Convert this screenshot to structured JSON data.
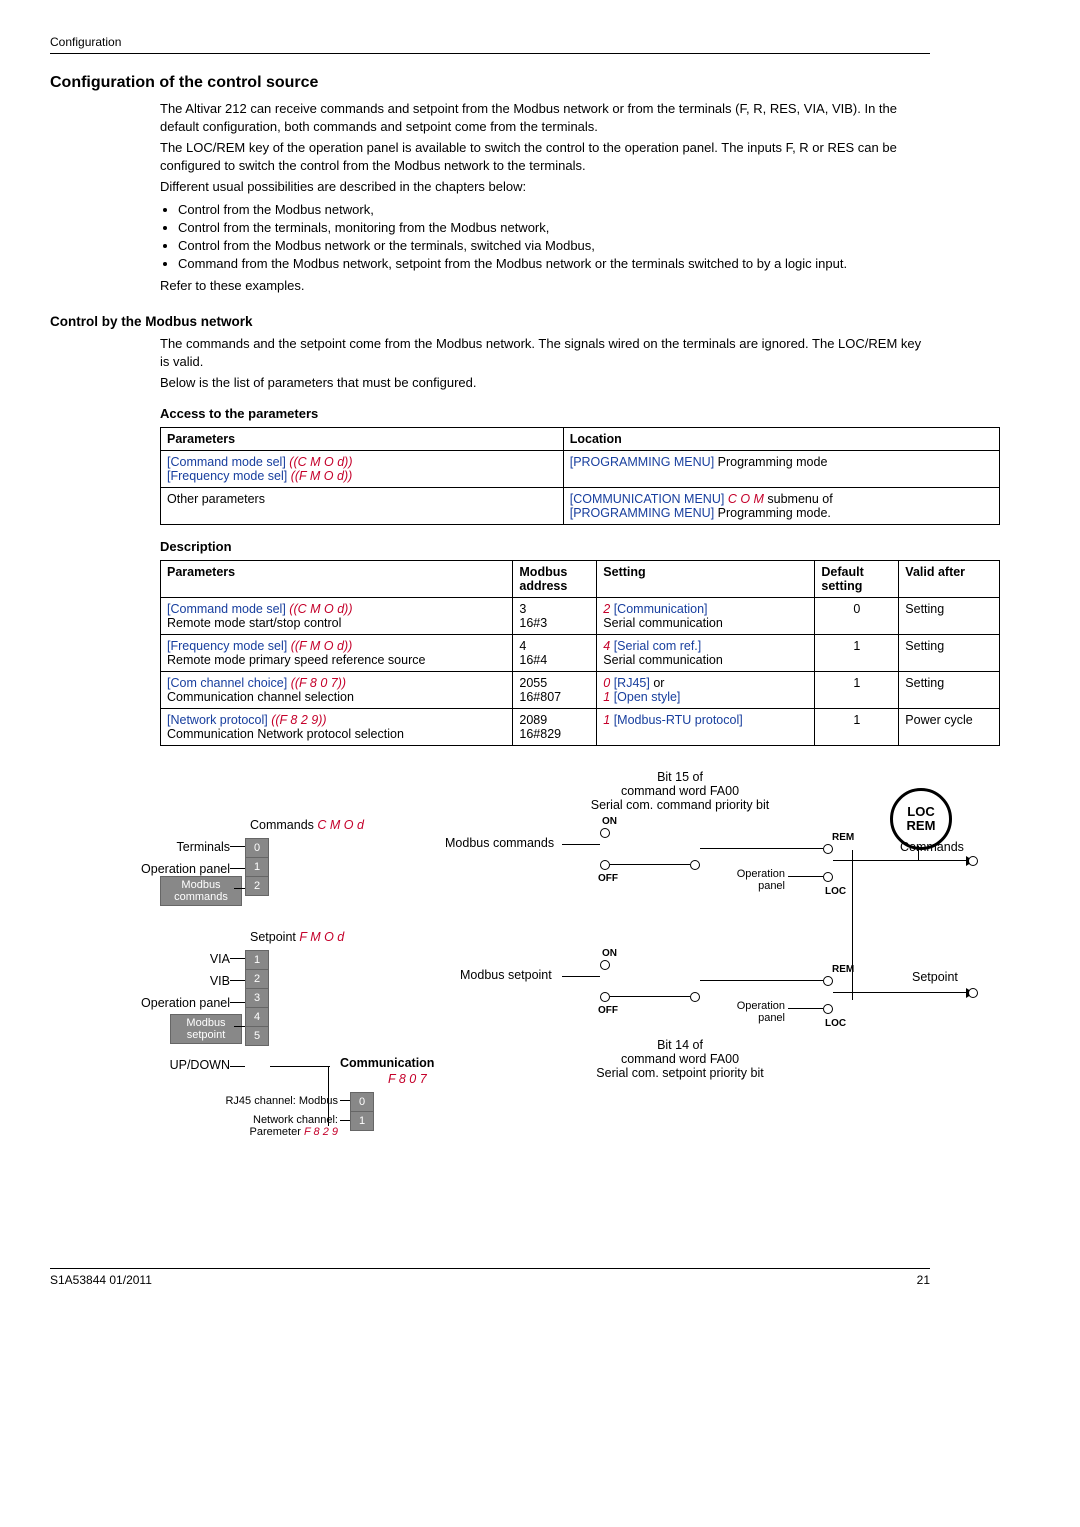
{
  "header": {
    "section": "Configuration"
  },
  "title": "Configuration of the control source",
  "intro": {
    "p1": "The Altivar 212 can receive commands and setpoint from the Modbus network or from the terminals (F, R, RES, VIA, VIB). In the default configuration, both commands and setpoint come from the terminals.",
    "p2": "The LOC/REM key of the operation panel is available to switch the control to the operation panel. The inputs F, R or RES can be configured to switch the control from the Modbus network to the terminals.",
    "p3": "Different usual possibilities are described in the chapters below:",
    "b1": "Control from the Modbus network,",
    "b2": "Control from the terminals, monitoring from the Modbus network,",
    "b3": "Control from the Modbus network or the terminals, switched via Modbus,",
    "b4": "Command from the Modbus network, setpoint from the Modbus network or the terminals switched to by a logic input.",
    "p4": "Refer to these examples."
  },
  "sec1": {
    "h": "Control by the Modbus network",
    "p1": "The commands and the setpoint come from the Modbus network. The signals wired on the terminals are ignored. The LOC/REM key is valid.",
    "p2": "Below is the list of parameters that must be configured."
  },
  "access": {
    "h": "Access to the parameters",
    "th1": "Parameters",
    "th2": "Location",
    "r1c1a": "[Command mode sel]",
    "r1c1b": "(C M O d)",
    "r1c1c": "[Frequency mode sel]",
    "r1c1d": "(F M O d)",
    "r1c2a": "[PROGRAMMING MENU]",
    "r1c2b": " Programming mode",
    "r2c1": "Other parameters",
    "r2c2a": "[COMMUNICATION MENU] ",
    "r2c2b": "C O M",
    "r2c2c": " submenu of",
    "r2c2d": "[PROGRAMMING MENU]",
    "r2c2e": " Programming mode."
  },
  "desc": {
    "h": "Description",
    "th1": "Parameters",
    "th2": "Modbus address",
    "th3": "Setting",
    "th4": "Default setting",
    "th5": "Valid after",
    "rows": [
      {
        "p_blue": "[Command mode sel]",
        "p_red": "(C M O d)",
        "p_txt": "Remote mode start/stop control",
        "addr1": "3",
        "addr2": "16#3",
        "s_red": "2",
        "s_blue": " [Communication]",
        "s_txt": "Serial communication",
        "def": "0",
        "valid": "Setting"
      },
      {
        "p_blue": "[Frequency mode sel]",
        "p_red": "(F M O d)",
        "p_txt": "Remote mode primary speed reference source",
        "addr1": "4",
        "addr2": "16#4",
        "s_red": "4",
        "s_blue": " [Serial com ref.]",
        "s_txt": "Serial communication",
        "def": "1",
        "valid": "Setting"
      },
      {
        "p_blue": "[Com channel choice]",
        "p_red": "(F 8 0 7)",
        "p_txt": "Communication channel selection",
        "addr1": "2055",
        "addr2": "16#807",
        "s_red": "0",
        "s_blue": " [RJ45]",
        "s_extra": " or",
        "s_red2": "1",
        "s_blue2": " [Open style]",
        "def": "1",
        "valid": "Setting"
      },
      {
        "p_blue": "[Network protocol]",
        "p_red": "(F 8 2 9)",
        "p_txt": "Communication Network protocol selection",
        "addr1": "2089",
        "addr2": "16#829",
        "s_red": "1",
        "s_blue": " [Modbus-RTU protocol]",
        "def": "1",
        "valid": "Power cycle"
      }
    ]
  },
  "diagram": {
    "bit15a": "Bit 15 of",
    "bit15b": "command word FA00",
    "bit15c": "Serial com. command priority bit",
    "bit14a": "Bit 14 of",
    "bit14b": "command word FA00",
    "bit14c": "Serial com. setpoint priority bit",
    "commands_hdr": "Commands ",
    "commands_code": "C M O d",
    "setpoint_hdr": "Setpoint ",
    "setpoint_code": "F M O d",
    "terminals": "Terminals",
    "oppanel": "Operation panel",
    "modbus_cmd": "Modbus\ncommands",
    "modbus_sp": "Modbus\nsetpoint",
    "via": "VIA",
    "vib": "VIB",
    "updown": "UP/DOWN",
    "modbus_commands": "Modbus commands",
    "modbus_setpoint": "Modbus setpoint",
    "on": "ON",
    "off": "OFF",
    "rem": "REM",
    "loc": "LOC",
    "operation": "Operation",
    "panel": "panel",
    "commands_out": "Commands",
    "setpoint_out": "Setpoint",
    "communication": "Communication",
    "f807": "F 8 0 7",
    "rj45": "RJ45 channel: Modbus",
    "netch": "Network channel:",
    "netch2": "Paremeter ",
    "netch2code": "F 8 2 9",
    "locrem_top": "LOC",
    "locrem_bot": "REM"
  },
  "footer": {
    "left": "S1A53844 01/2011",
    "right": "21"
  }
}
